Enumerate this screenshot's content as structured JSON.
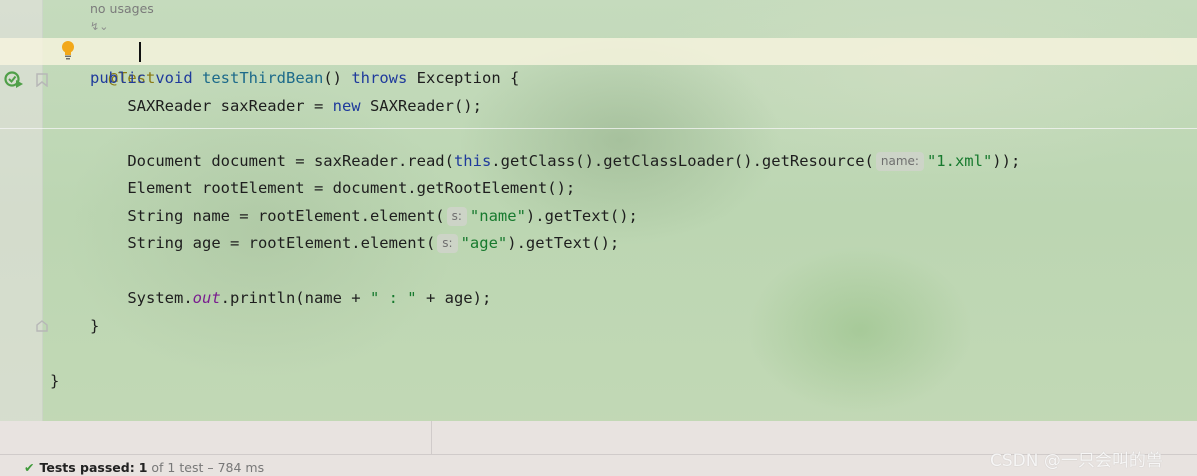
{
  "editor": {
    "usages_hint": "no usages",
    "lens_label": "↯⌄",
    "lines": {
      "l1_annotation": "@Test",
      "l2": {
        "kw1": "public",
        "kw2": "void",
        "method": "testThirdBean",
        "paren": "() ",
        "kw3": "throws",
        "rest": " Exception {"
      },
      "l3": {
        "pre": "    SAXReader saxReader = ",
        "kw": "new",
        "post": " SAXReader();"
      },
      "l5": {
        "pre": "    Document document = saxReader.read(",
        "kw": "this",
        "mid": ".getClass().getClassLoader().getResource(",
        "hint": "name:",
        "str": "\"1.xml\"",
        "post": "));"
      },
      "l6": {
        "text": "    Element rootElement = document.getRootElement();"
      },
      "l7": {
        "pre": "    String name = rootElement.element(",
        "hint": "s:",
        "str": "\"name\"",
        "post": ").getText();"
      },
      "l8": {
        "pre": "    String age = rootElement.element(",
        "hint": "s:",
        "str": "\"age\"",
        "post": ").getText();"
      },
      "l10": {
        "pre": "    System.",
        "field": "out",
        "mid": ".println(name + ",
        "str": "\" : \"",
        "post": " + age);"
      },
      "l11": "}",
      "l13": "}"
    }
  },
  "status_bar": {
    "check": "✔",
    "passed_label": "Tests passed:",
    "passed_count": "1",
    "of_total": "of 1 test",
    "duration": "– 784 ms"
  },
  "watermark": "CSDN @一只会叫的兽",
  "colors": {
    "keyword": "#1f3a9c",
    "method": "#1c6a8a",
    "string": "#177a2e",
    "annotation": "#8a7a14",
    "field": "#7a1f8f",
    "passed": "#3f9a3a"
  },
  "icons": [
    "lightbulb-icon",
    "run-test-icon",
    "bookmark-icon",
    "fold-icon",
    "check-icon"
  ]
}
